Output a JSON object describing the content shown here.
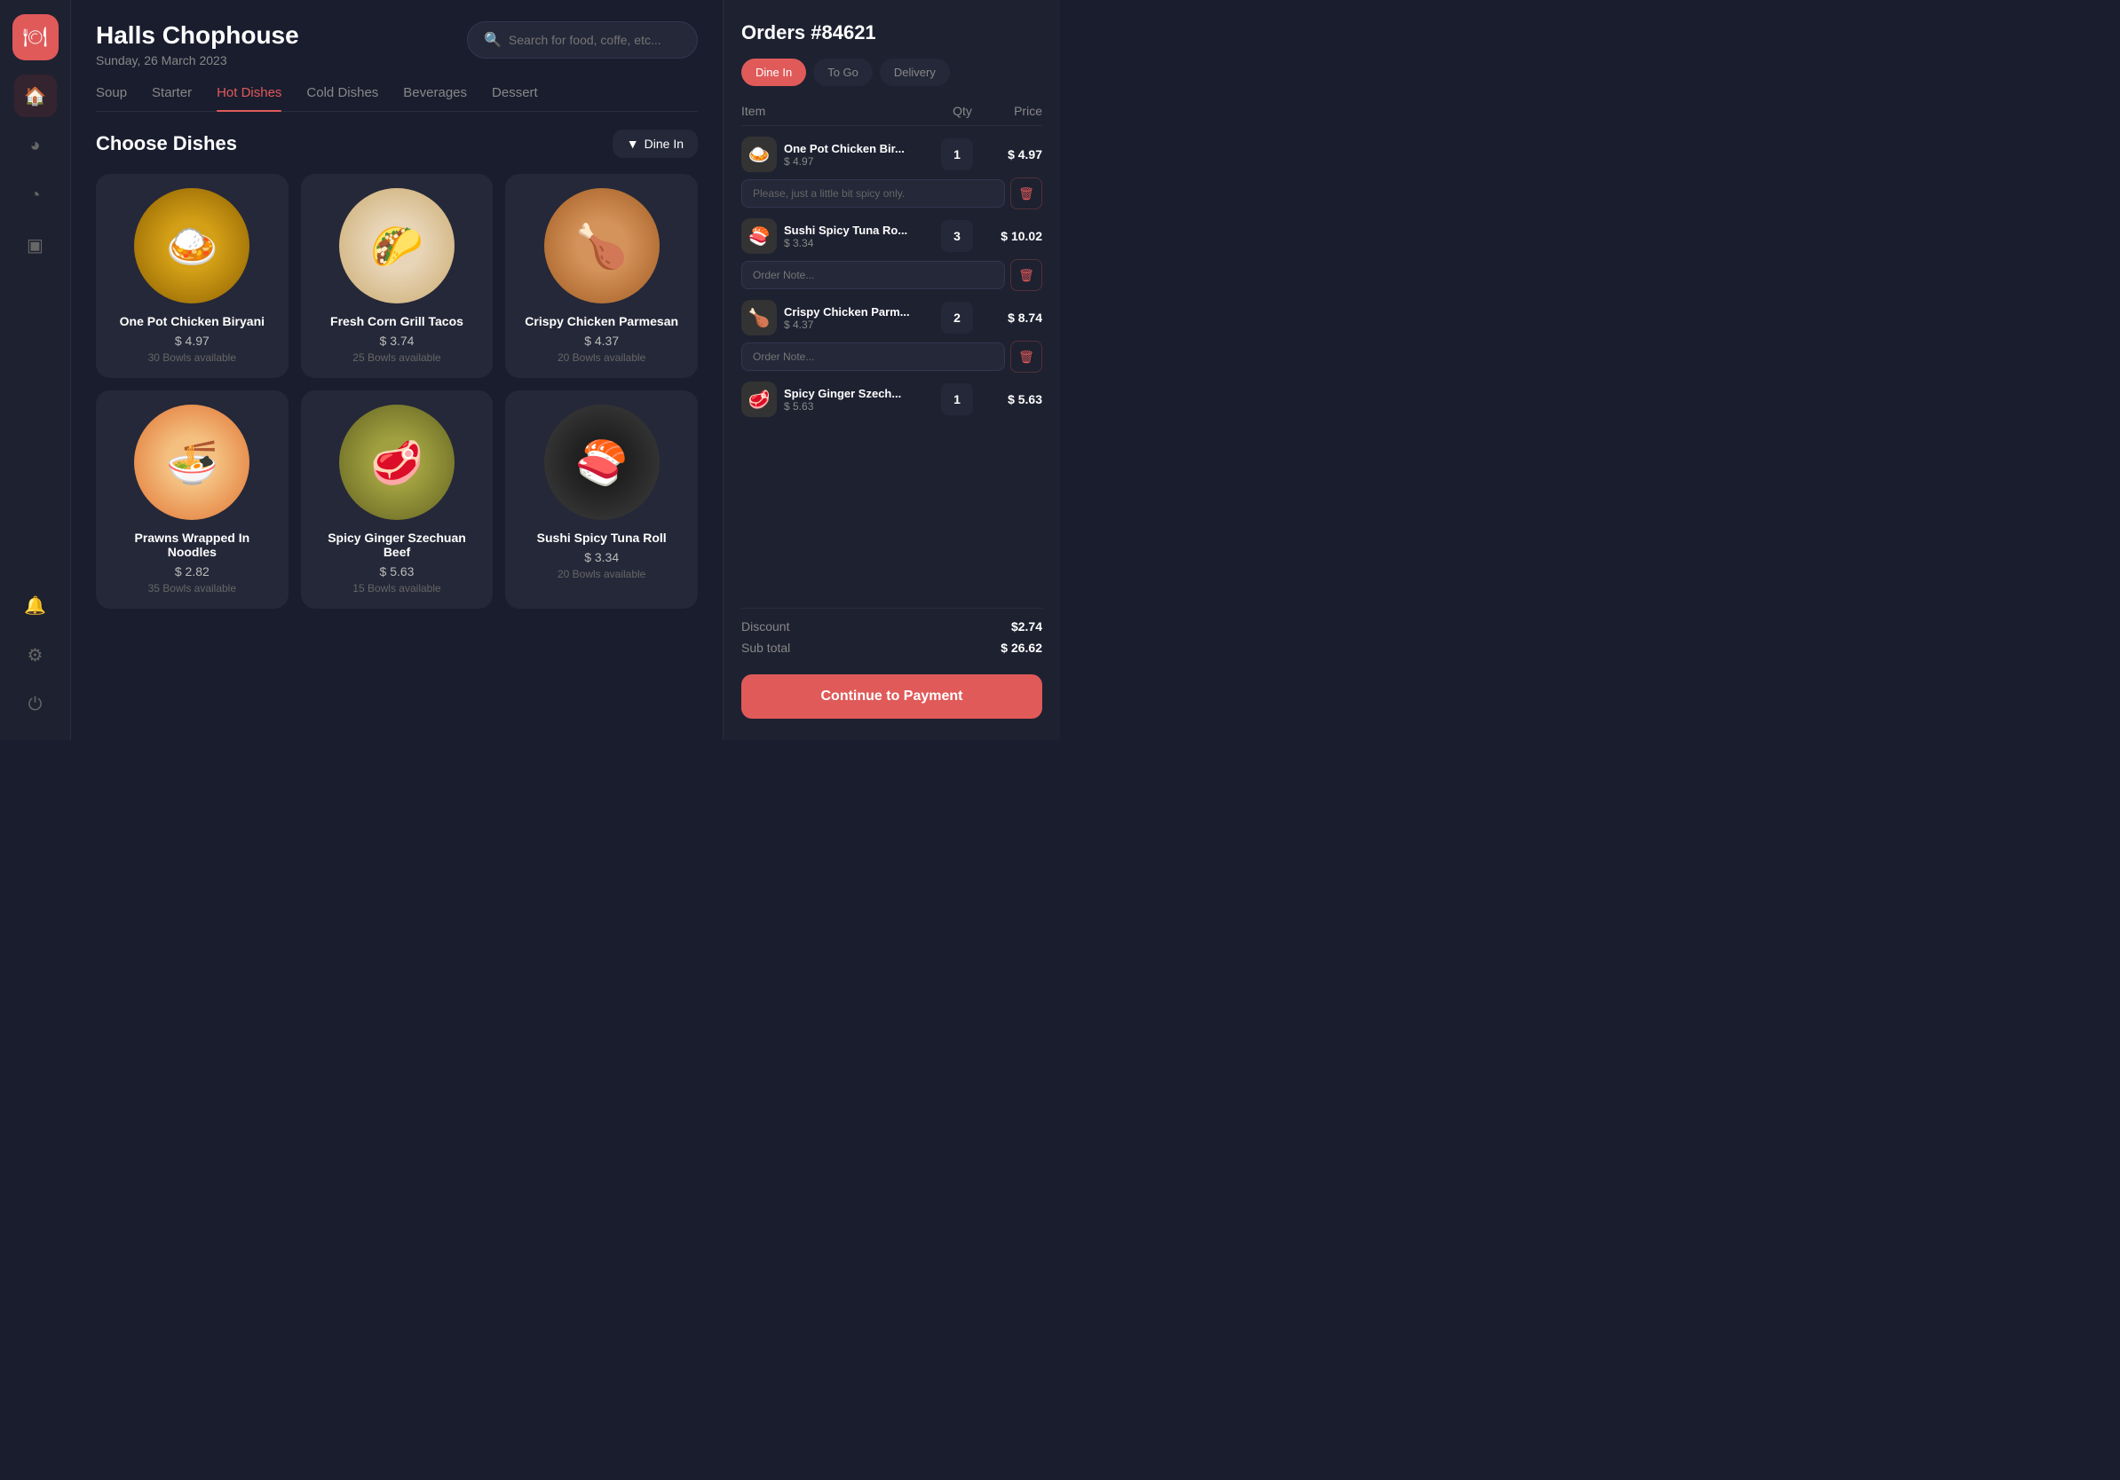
{
  "app": {
    "logo_icon": "🍽",
    "logo_alt": "restaurant logo"
  },
  "sidebar": {
    "icons": [
      {
        "name": "home-icon",
        "symbol": "⌂",
        "active": true
      },
      {
        "name": "orders-icon",
        "symbol": "◕",
        "active": false
      },
      {
        "name": "chart-icon",
        "symbol": "◔",
        "active": false
      },
      {
        "name": "inbox-icon",
        "symbol": "▣",
        "active": false
      },
      {
        "name": "notification-icon",
        "symbol": "🔔",
        "active": false
      },
      {
        "name": "settings-icon",
        "symbol": "⚙",
        "active": false
      },
      {
        "name": "logout-icon",
        "symbol": "⏻",
        "active": false
      }
    ]
  },
  "header": {
    "restaurant_name": "Halls Chophouse",
    "date": "Sunday, 26 March 2023",
    "search_placeholder": "Search for food, coffe, etc..."
  },
  "nav_tabs": [
    {
      "label": "Soup",
      "active": false
    },
    {
      "label": "Starter",
      "active": false
    },
    {
      "label": "Hot Dishes",
      "active": true
    },
    {
      "label": "Cold Dishes",
      "active": false
    },
    {
      "label": "Beverages",
      "active": false
    },
    {
      "label": "Dessert",
      "active": false
    }
  ],
  "dishes_section": {
    "title": "Choose Dishes",
    "dine_in_label": "Dine In"
  },
  "dishes": [
    {
      "name": "One Pot Chicken Biryani",
      "price": "$ 4.97",
      "availability": "30 Bowls available",
      "food_class": "food-biryani",
      "emoji": "🍛"
    },
    {
      "name": "Fresh Corn Grill Tacos",
      "price": "$ 3.74",
      "availability": "25 Bowls available",
      "food_class": "food-tacos",
      "emoji": "🌮"
    },
    {
      "name": "Crispy Chicken Parmesan",
      "price": "$ 4.37",
      "availability": "20 Bowls available",
      "food_class": "food-parmesan",
      "emoji": "🍗"
    },
    {
      "name": "Prawns Wrapped In Noodles",
      "price": "$ 2.82",
      "availability": "35 Bowls available",
      "food_class": "food-prawns",
      "emoji": "🍜"
    },
    {
      "name": "Spicy Ginger Szechuan Beef",
      "price": "$ 5.63",
      "availability": "15 Bowls available",
      "food_class": "food-szechuan",
      "emoji": "🥩"
    },
    {
      "name": "Sushi Spicy Tuna Roll",
      "price": "$ 3.34",
      "availability": "20 Bowls available",
      "food_class": "food-sushi",
      "emoji": "🍣"
    }
  ],
  "order_panel": {
    "title": "Orders #84621",
    "tabs": [
      {
        "label": "Dine In",
        "active": true
      },
      {
        "label": "To Go",
        "active": false
      },
      {
        "label": "Delivery",
        "active": false
      }
    ],
    "columns": {
      "item": "Item",
      "qty": "Qty",
      "price": "Price"
    },
    "items": [
      {
        "name": "One Pot Chicken Bir...",
        "price": "$ 4.97",
        "qty": 1,
        "total": "$ 4.97",
        "note_placeholder": "Please, just a little bit spicy only.",
        "emoji": "🍛"
      },
      {
        "name": "Sushi Spicy Tuna Ro...",
        "price": "$ 3.34",
        "qty": 3,
        "total": "$ 10.02",
        "note_placeholder": "Order Note...",
        "emoji": "🍣"
      },
      {
        "name": "Crispy Chicken Parm...",
        "price": "$ 4.37",
        "qty": 2,
        "total": "$ 8.74",
        "note_placeholder": "Order Note...",
        "emoji": "🍗"
      },
      {
        "name": "Spicy Ginger Szech...",
        "price": "$ 5.63",
        "qty": 1,
        "total": "$ 5.63",
        "note_placeholder": null,
        "emoji": "🥩"
      }
    ],
    "discount_label": "Discount",
    "discount_value": "$2.74",
    "subtotal_label": "Sub total",
    "subtotal_value": "$ 26.62",
    "continue_button": "Continue to Payment"
  }
}
